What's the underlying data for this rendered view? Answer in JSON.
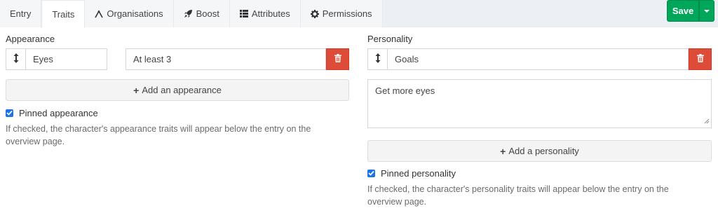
{
  "tabs": [
    {
      "label": "Entry",
      "icon": ""
    },
    {
      "label": "Traits",
      "icon": ""
    },
    {
      "label": "Organisations",
      "icon": "organisation-icon"
    },
    {
      "label": "Boost",
      "icon": "rocket-icon"
    },
    {
      "label": "Attributes",
      "icon": "list-icon"
    },
    {
      "label": "Permissions",
      "icon": "gear-icon"
    }
  ],
  "active_tab": "Traits",
  "toolbar": {
    "save_label": "Save"
  },
  "appearance": {
    "title": "Appearance",
    "trait_name": "Eyes",
    "trait_value": "At least 3",
    "add_label": "Add an appearance",
    "pinned_label": "Pinned appearance",
    "pinned_checked": true,
    "help": "If checked, the character's appearance traits will appear below the entry on the overview page."
  },
  "personality": {
    "title": "Personality",
    "trait_name": "Goals",
    "trait_value": "Get more eyes",
    "add_label": "Add a personality",
    "pinned_label": "Pinned personality",
    "pinned_checked": true,
    "help": "If checked, the character's personality traits will appear below the entry on the overview page."
  },
  "colors": {
    "save_green": "#00a65a",
    "delete_red": "#dd4b39",
    "checkbox_blue": "#1a73e8"
  }
}
